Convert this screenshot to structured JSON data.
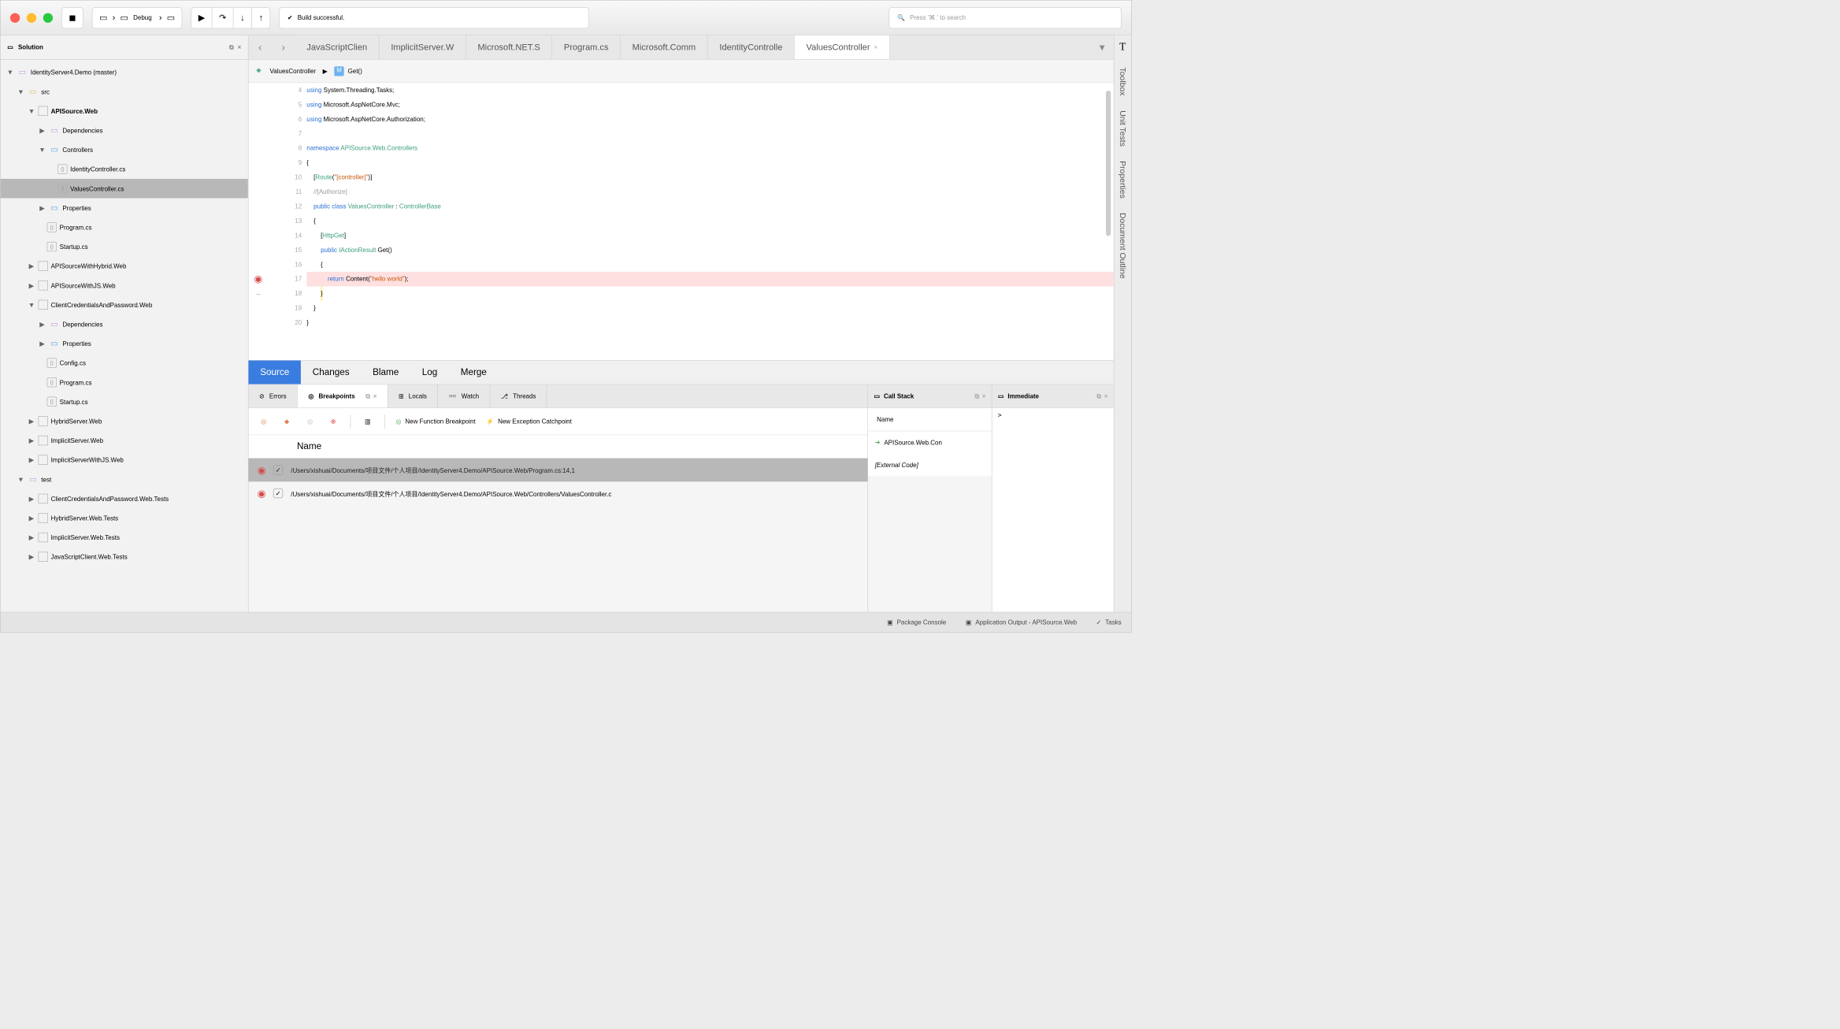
{
  "toolbar": {
    "config_left": "Debug",
    "status": "Build successful.",
    "search_placeholder": "Press '⌘.' to search"
  },
  "sidebar": {
    "title": "Solution",
    "root": "IdentityServer4.Demo (master)",
    "src": "src",
    "api": "APISource.Web",
    "deps": "Dependencies",
    "ctrl": "Controllers",
    "idctrl": "IdentityController.cs",
    "valctrl": "ValuesController.cs",
    "props": "Properties",
    "prog": "Program.cs",
    "startup": "Startup.cs",
    "hybrid": "APISourceWithHybrid.Web",
    "js": "APISourceWithJS.Web",
    "cc": "ClientCredentialsAndPassword.Web",
    "config": "Config.cs",
    "hs": "HybridServer.Web",
    "is": "ImplicitServer.Web",
    "isjs": "ImplicitServerWithJS.Web",
    "test": "test",
    "t1": "ClientCredentialsAndPassword.Web.Tests",
    "t2": "HybridServer.Web.Tests",
    "t3": "ImplicitServer.Web.Tests",
    "t4": "JavaScriptClient.Web.Tests"
  },
  "tabs": [
    "JavaScriptClien",
    "ImplicitServer.W",
    "Microsoft.NET.S",
    "Program.cs",
    "Microsoft.Comm",
    "IdentityControlle",
    "ValuesController"
  ],
  "breadcrumb": {
    "class": "ValuesController",
    "method": "Get()"
  },
  "code": {
    "lines": [
      {
        "n": 4,
        "html": "<span class='kw'>using</span> System.Threading.Tasks;"
      },
      {
        "n": 5,
        "html": "<span class='kw'>using</span> Microsoft.AspNetCore.Mvc;"
      },
      {
        "n": 6,
        "html": "<span class='kw'>using</span> Microsoft.AspNetCore.Authorization;"
      },
      {
        "n": 7,
        "html": ""
      },
      {
        "n": 8,
        "html": "<span class='kw'>namespace</span> <span class='typ'>APISource.Web.Controllers</span>"
      },
      {
        "n": 9,
        "html": "{"
      },
      {
        "n": 10,
        "html": "    [<span class='attr'>Route</span>(<span class='str'>\"[controller]\"</span>)]"
      },
      {
        "n": 11,
        "html": "    <span class='cmt'>//[Authorize]</span>"
      },
      {
        "n": 12,
        "html": "    <span class='kw'>public</span> <span class='kw'>class</span> <span class='typ'>ValuesController</span> : <span class='typ'>ControllerBase</span>"
      },
      {
        "n": 13,
        "html": "    {"
      },
      {
        "n": 14,
        "html": "        [<span class='attr'>HttpGet</span>]"
      },
      {
        "n": 15,
        "html": "        <span class='kw'>public</span> <span class='typ'>IActionResult</span> Get()"
      },
      {
        "n": 16,
        "html": "        {"
      },
      {
        "n": 17,
        "html": "            <span class='kw'>return</span> Content(<span class='str'>\"hello world\"</span>);",
        "bp": true,
        "hl": "red"
      },
      {
        "n": 18,
        "html": "        <span class='hl-yel'>}</span>",
        "arrow": true
      },
      {
        "n": 19,
        "html": "    }"
      },
      {
        "n": 20,
        "html": "}"
      }
    ]
  },
  "sourcebar": [
    "Source",
    "Changes",
    "Blame",
    "Log",
    "Merge"
  ],
  "btabs": {
    "errors": "Errors",
    "bp": "Breakpoints",
    "locals": "Locals",
    "watch": "Watch",
    "threads": "Threads"
  },
  "bptool": {
    "nfb": "New Function Breakpoint",
    "nec": "New Exception Catchpoint"
  },
  "bphead": "Name",
  "bprows": [
    "/Users/xishuai/Documents/项目文件/个人项目/IdentityServer4.Demo/APISource.Web/Program.cs:14,1",
    "/Users/xishuai/Documents/项目文件/个人项目/IdentityServer4.Demo/APISource.Web/Controllers/ValuesController.c"
  ],
  "callstack": {
    "title": "Call Stack",
    "head": "Name",
    "rows": [
      "APISource.Web.Con",
      "[External Code]"
    ]
  },
  "immediate": {
    "title": "Immediate",
    "prompt": ">"
  },
  "rightbar": [
    "Toolbox",
    "Unit Tests",
    "Properties",
    "Document Outline"
  ],
  "statusbar": {
    "pc": "Package Console",
    "ao": "Application Output - APISource.Web",
    "tasks": "Tasks"
  }
}
